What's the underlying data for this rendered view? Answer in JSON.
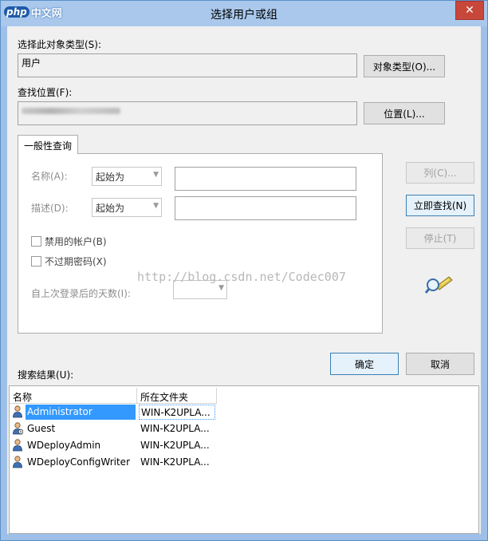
{
  "window": {
    "title": "选择用户或组",
    "logo_php": "php",
    "logo_cn": "中文网",
    "close_glyph": "✕"
  },
  "object_type": {
    "label": "选择此对象类型(S):",
    "value": "用户",
    "button": "对象类型(O)..."
  },
  "location": {
    "label": "查找位置(F):",
    "value": "",
    "button": "位置(L)..."
  },
  "tab": {
    "label": "一般性查询"
  },
  "query": {
    "name_label": "名称(A):",
    "name_mode": "起始为",
    "desc_label": "描述(D):",
    "desc_mode": "起始为",
    "disabled_accounts": "禁用的帐户(B)",
    "non_expiring_pw": "不过期密码(X)",
    "days_label": "自上次登录后的天数(I):"
  },
  "buttons": {
    "columns": "列(C)...",
    "find_now": "立即查找(N)",
    "stop": "停止(T)",
    "ok": "确定",
    "cancel": "取消"
  },
  "watermark": "http://blog.csdn.net/Codec007",
  "results": {
    "label": "搜索结果(U):",
    "col_name": "名称",
    "col_folder": "所在文件夹",
    "rows": [
      {
        "name": "Administrator",
        "folder": "WIN-K2UPLA..."
      },
      {
        "name": "Guest",
        "folder": "WIN-K2UPLA..."
      },
      {
        "name": "WDeployAdmin",
        "folder": "WIN-K2UPLA..."
      },
      {
        "name": "WDeployConfigWriter",
        "folder": "WIN-K2UPLA..."
      }
    ]
  },
  "colors": {
    "title_bar": "#a9c8ec",
    "close": "#c7483a",
    "selection": "#3399ff"
  }
}
